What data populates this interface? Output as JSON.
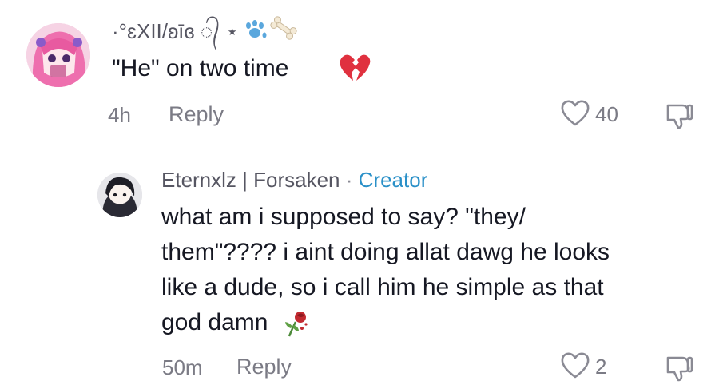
{
  "comments": [
    {
      "username": "·°ɛXII/ʚīɞ ᭄ ⋆",
      "text": "\"He\" on two time",
      "emoji": "broken-heart-icon",
      "timestamp": "4h",
      "reply_label": "Reply",
      "like_count": "40"
    },
    {
      "username": "Eternxlz | Forsaken",
      "separator": "·",
      "badge": "Creator",
      "text_lines": [
        "what am i supposed to say? \"they/",
        "them\"???? i aint doing allat dawg he looks",
        "like a dude, so i call him he simple as that",
        "god damn"
      ],
      "emoji": "wilted-rose-icon",
      "timestamp": "50m",
      "reply_label": "Reply",
      "like_count": "2"
    }
  ],
  "colors": {
    "text": "#161823",
    "muted": "#7b7b85",
    "creator_badge": "#2a90c8",
    "broken_heart": "#e0313f"
  }
}
